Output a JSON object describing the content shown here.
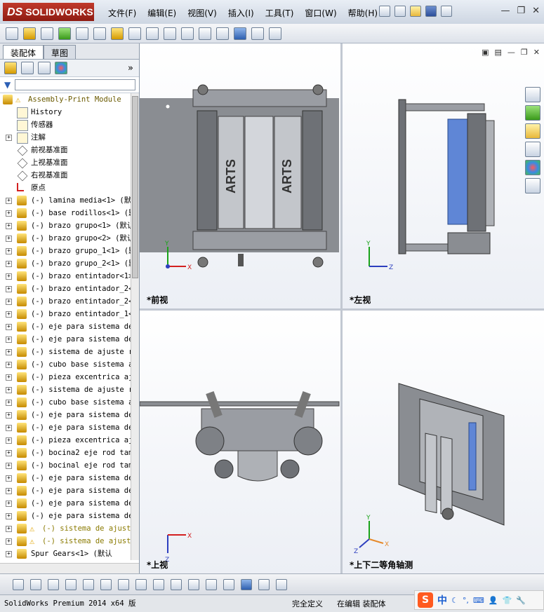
{
  "title": {
    "brand_prefix": "DS",
    "brand": "SOLIDWORKS"
  },
  "menu": [
    "文件(F)",
    "编辑(E)",
    "视图(V)",
    "插入(I)",
    "工具(T)",
    "窗口(W)",
    "帮助(H)"
  ],
  "tabs": [
    {
      "label": "装配体"
    },
    {
      "label": "草图"
    }
  ],
  "tree": {
    "root": "Assembly-Print Module",
    "items": [
      {
        "label": "History",
        "icon": "history-icon",
        "expander": false
      },
      {
        "label": "传感器",
        "icon": "sensor-icon",
        "expander": false
      },
      {
        "label": "注解",
        "icon": "annotation-icon",
        "expander": true
      },
      {
        "label": "前视基准面",
        "icon": "plane-icon",
        "expander": false
      },
      {
        "label": "上视基准面",
        "icon": "plane-icon",
        "expander": false
      },
      {
        "label": "右视基准面",
        "icon": "plane-icon",
        "expander": false
      },
      {
        "label": "原点",
        "icon": "origin-icon",
        "expander": false
      },
      {
        "label": "(-) lamina media<1> (默",
        "icon": "part-icon",
        "expander": true
      },
      {
        "label": "(-) base rodillos<1> (默",
        "icon": "part-icon",
        "expander": true
      },
      {
        "label": "(-) brazo grupo<1> (默认",
        "icon": "part-icon",
        "expander": true
      },
      {
        "label": "(-) brazo grupo<2> (默认",
        "icon": "part-icon",
        "expander": true
      },
      {
        "label": "(-) brazo grupo_1<1> (默",
        "icon": "part-icon",
        "expander": true
      },
      {
        "label": "(-) brazo grupo_2<1> (默",
        "icon": "part-icon",
        "expander": true
      },
      {
        "label": "(-) brazo entintador<1>",
        "icon": "part-icon",
        "expander": true
      },
      {
        "label": "(-) brazo entintador_2<",
        "icon": "part-icon",
        "expander": true
      },
      {
        "label": "(-) brazo entintador_2<",
        "icon": "part-icon",
        "expander": true
      },
      {
        "label": "(-) brazo entintador_1<",
        "icon": "part-icon",
        "expander": true
      },
      {
        "label": "(-) eje para sistema de",
        "icon": "part-icon",
        "expander": true
      },
      {
        "label": "(-) eje para sistema de",
        "icon": "part-icon",
        "expander": true
      },
      {
        "label": "(-) sistema de ajuste r",
        "icon": "part-icon",
        "expander": true
      },
      {
        "label": "(-) cubo base sistema a",
        "icon": "part-icon",
        "expander": true
      },
      {
        "label": "(-) pieza excentrica aj",
        "icon": "part-icon",
        "expander": true
      },
      {
        "label": "(-) sistema de ajuste r",
        "icon": "part-icon",
        "expander": true
      },
      {
        "label": "(-) cubo base sistema a",
        "icon": "part-icon",
        "expander": true
      },
      {
        "label": "(-) eje para sistema de",
        "icon": "part-icon",
        "expander": true
      },
      {
        "label": "(-) eje para sistema de",
        "icon": "part-icon",
        "expander": true
      },
      {
        "label": "(-) pieza excentrica aj",
        "icon": "part-icon",
        "expander": true
      },
      {
        "label": "(-) bocina2 eje rod tam",
        "icon": "part-icon",
        "expander": true
      },
      {
        "label": "(-) bocinal eje rod tam",
        "icon": "part-icon",
        "expander": true
      },
      {
        "label": "(-) eje para sistema de",
        "icon": "part-icon",
        "expander": true
      },
      {
        "label": "(-) eje para sistema de",
        "icon": "part-icon",
        "expander": true
      },
      {
        "label": "(-) eje para sistema de",
        "icon": "part-icon",
        "expander": true
      },
      {
        "label": "(-) eje para sistema de",
        "icon": "part-icon",
        "expander": true
      },
      {
        "label": "(-) sistema de ajust",
        "icon": "warning-part-icon",
        "expander": true,
        "warning": true
      },
      {
        "label": "(-) sistema de ajust",
        "icon": "warning-part-icon",
        "expander": true,
        "warning": true
      },
      {
        "label": "Spur Gears<1> (默认",
        "icon": "subassembly-icon",
        "expander": true
      }
    ]
  },
  "views": {
    "front": {
      "label": "*前视",
      "axes": [
        "Y",
        "X"
      ]
    },
    "left": {
      "label": "*左视",
      "axes": [
        "Y",
        "Z"
      ]
    },
    "top": {
      "label": "*上视",
      "axes": [
        "Z",
        "X"
      ]
    },
    "iso": {
      "label": "*上下二等角轴测",
      "axes": [
        "Y",
        "Z",
        "X"
      ]
    }
  },
  "model_text": "ARTS",
  "status": {
    "product": "SolidWorks Premium 2014 x64 版",
    "definition": "完全定义",
    "mode": "在编辑 装配体"
  },
  "ime": {
    "logo": "S",
    "lang": "中"
  },
  "colors": {
    "accent_blue": "#4a74c9",
    "roller_blue": "#5f86d6",
    "plate_gray": "#8a8d92",
    "brand_red": "#b52c1f"
  }
}
